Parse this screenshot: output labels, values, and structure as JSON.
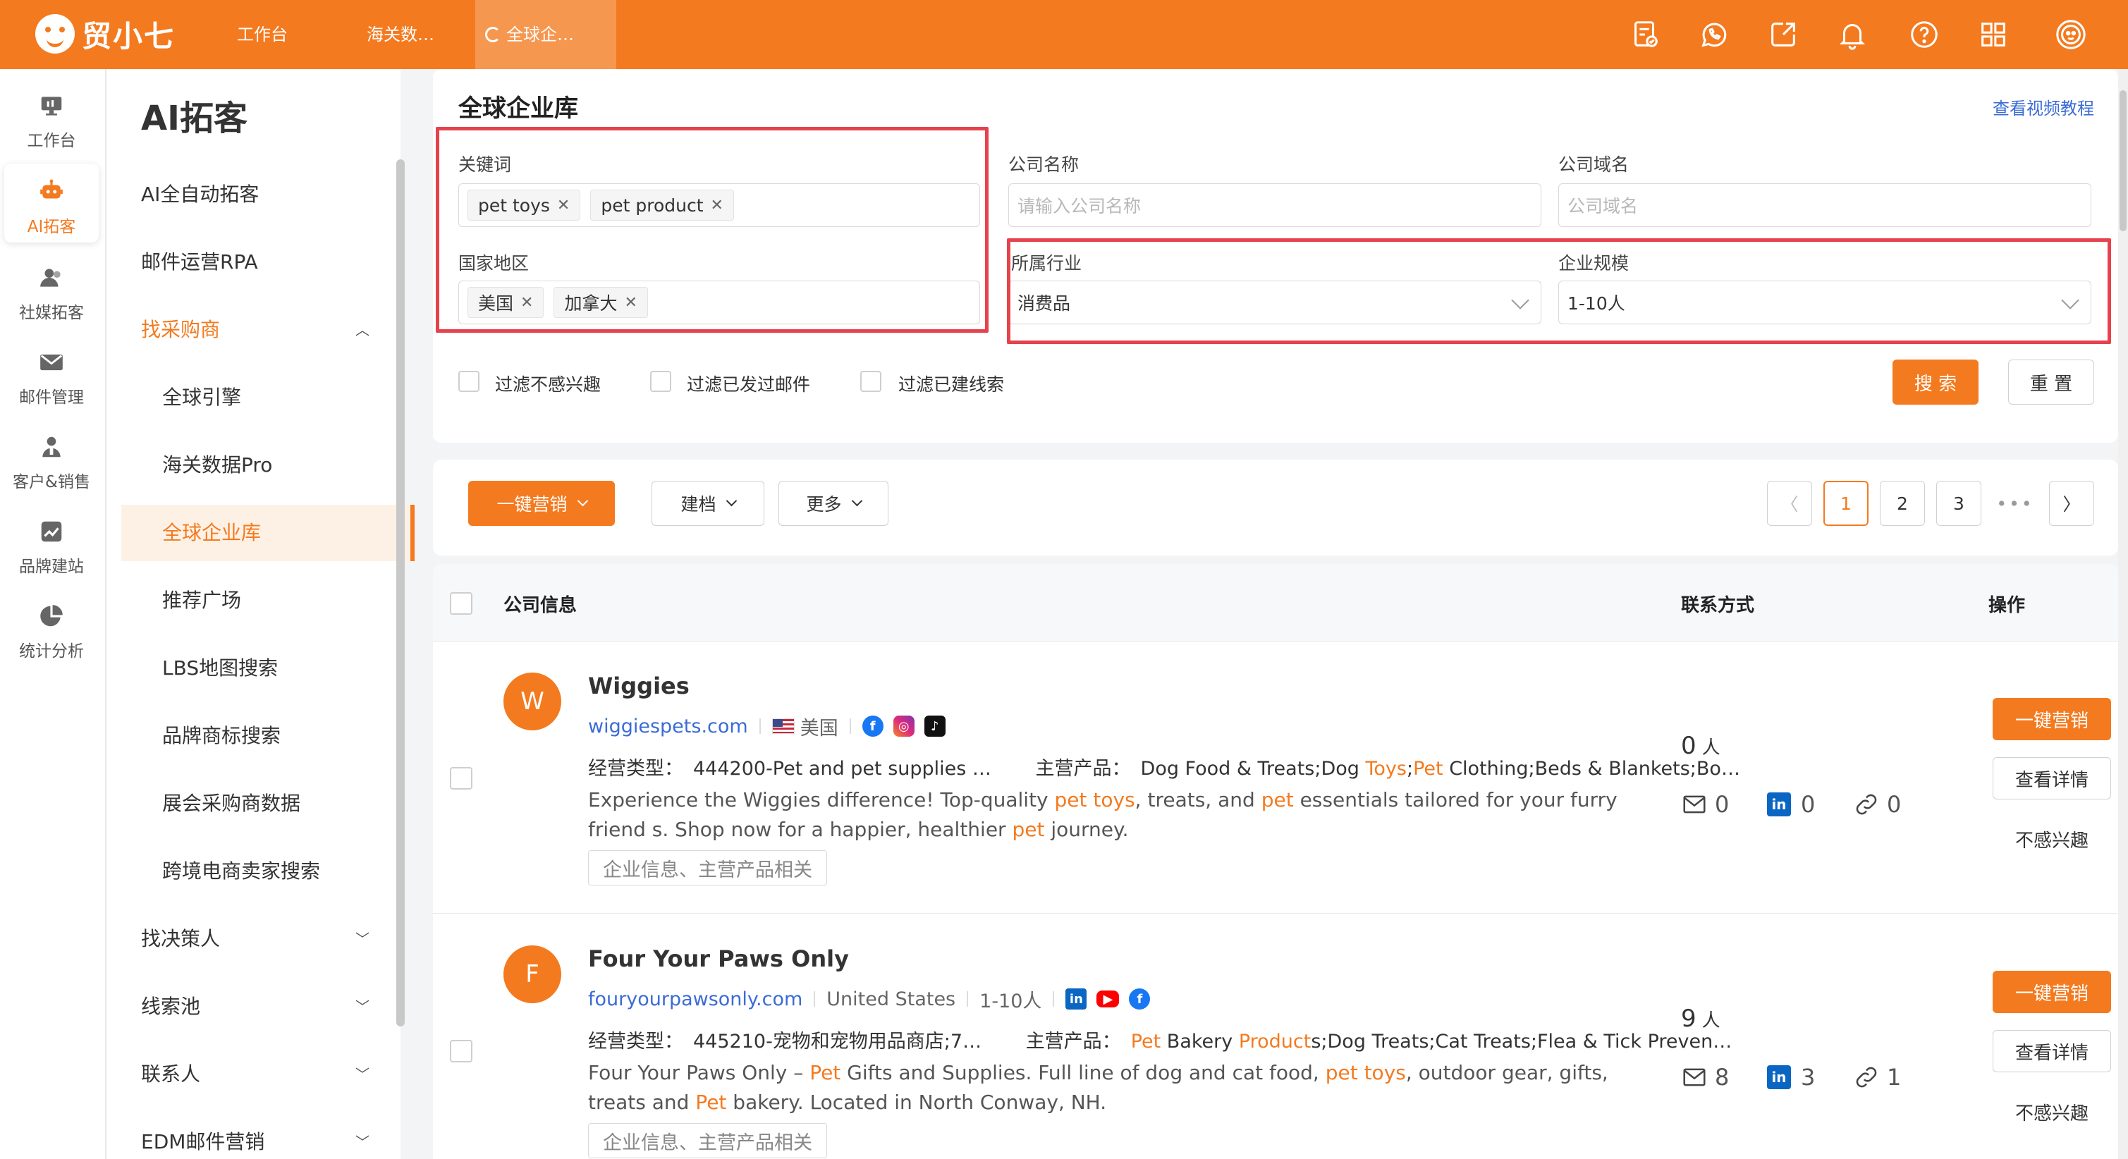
{
  "app": {
    "brand": "贸小七",
    "top_tabs": [
      {
        "label": "工作台"
      },
      {
        "label": "海关数…"
      },
      {
        "label": "全球企…"
      }
    ],
    "top_icons": [
      "task-check-icon",
      "whatsapp-icon",
      "export-icon",
      "bell-icon",
      "help-icon",
      "apps-grid-icon",
      "user-avatar-icon"
    ]
  },
  "rail": [
    {
      "label": "工作台",
      "icon": "monitor-icon"
    },
    {
      "label": "AI拓客",
      "icon": "robot-icon"
    },
    {
      "label": "社媒拓客",
      "icon": "people-icon"
    },
    {
      "label": "邮件管理",
      "icon": "mail-icon"
    },
    {
      "label": "客户&销售",
      "icon": "customer-icon"
    },
    {
      "label": "品牌建站",
      "icon": "chart-square-icon"
    },
    {
      "label": "统计分析",
      "icon": "pie-icon"
    }
  ],
  "sidebar": {
    "title": "AI拓客",
    "items": [
      {
        "label": "AI全自动拓客"
      },
      {
        "label": "邮件运营RPA"
      },
      {
        "label": "找采购商"
      },
      {
        "label": "全球引擎"
      },
      {
        "label": "海关数据Pro"
      },
      {
        "label": "全球企业库"
      },
      {
        "label": "推荐广场"
      },
      {
        "label": "LBS地图搜索"
      },
      {
        "label": "品牌商标搜索"
      },
      {
        "label": "展会采购商数据"
      },
      {
        "label": "跨境电商卖家搜索"
      },
      {
        "label": "找决策人"
      },
      {
        "label": "线索池"
      },
      {
        "label": "联系人"
      },
      {
        "label": "EDM邮件营销"
      }
    ]
  },
  "search": {
    "title": "全球企业库",
    "video_link": "查看视频教程",
    "keyword_label": "关键词",
    "keyword_tags": [
      "pet toys",
      "pet product"
    ],
    "company_label": "公司名称",
    "company_placeholder": "请输入公司名称",
    "domain_label": "公司域名",
    "domain_placeholder": "公司域名",
    "region_label": "国家地区",
    "region_tags": [
      "美国",
      "加拿大"
    ],
    "industry_label": "所属行业",
    "industry_value": "消费品",
    "scale_label": "企业规模",
    "scale_value": "1-10人",
    "filters": [
      "过滤不感兴趣",
      "过滤已发过邮件",
      "过滤已建线索"
    ],
    "search_button": "搜 索",
    "reset_button": "重 置"
  },
  "toolbar": {
    "marketing": "一键营销",
    "archive": "建档",
    "more": "更多",
    "pages": [
      "1",
      "2",
      "3"
    ],
    "ellipsis": "•••"
  },
  "table": {
    "col_company": "公司信息",
    "col_contact": "联系方式",
    "col_action": "操作"
  },
  "results": [
    {
      "initial": "W",
      "name": "Wiggies",
      "domain": "wiggiespets.com",
      "country": "美国",
      "business_key": "经营类型：",
      "business_val": "444200-Pet and pet supplies …",
      "product_key": "主营产品：",
      "products_pre": "Dog Food & Treats;Dog ",
      "products_h1": "Toys",
      "products_mid": ";",
      "products_h2": "Pet",
      "products_post": " Clothing;Beds & Blankets;Bo…",
      "desc_1": "Experience the Wiggies difference! Top-quality ",
      "desc_h1": "pet toys",
      "desc_2": ", treats, and ",
      "desc_h2": "pet",
      "desc_3": " essentials tailored for your furry friend s. Shop now for a happier, healthier ",
      "desc_h3": "pet",
      "desc_4": " journey.",
      "tag": "企业信息、主营产品相关",
      "people": "0",
      "people_unit": "人",
      "emails": "0",
      "linkedin": "0",
      "links": "0"
    },
    {
      "initial": "F",
      "name": "Four Your Paws Only",
      "domain": "fouryourpawsonly.com",
      "country": "United States",
      "size": "1-10人",
      "business_key": "经营类型：",
      "business_val": "445210-宠物和宠物用品商店;7…",
      "product_key": "主营产品：",
      "products_h1": "Pet",
      "products_mid": " Bakery ",
      "products_h2": "Product",
      "products_post": "s;Dog Treats;Cat Treats;Flea & Tick Preven…",
      "desc_1": "Four Your Paws Only – ",
      "desc_h1": "Pet",
      "desc_2": " Gifts and Supplies. Full line of dog and cat food, ",
      "desc_h2": "pet toys",
      "desc_3": ", outdoor gear, gifts, treats and ",
      "desc_h3": "Pet",
      "desc_4": " bakery. Located in North Conway, NH.",
      "tag": "企业信息、主营产品相关",
      "people": "9",
      "people_unit": "人",
      "emails": "8",
      "linkedin": "3",
      "links": "1"
    }
  ],
  "row_actions": {
    "marketing": "一键营销",
    "detail": "查看详情",
    "not_interested": "不感兴趣"
  },
  "colors": {
    "accent": "#f47a1f",
    "highlight_border": "#e5424d",
    "link": "#3b6bd6"
  }
}
